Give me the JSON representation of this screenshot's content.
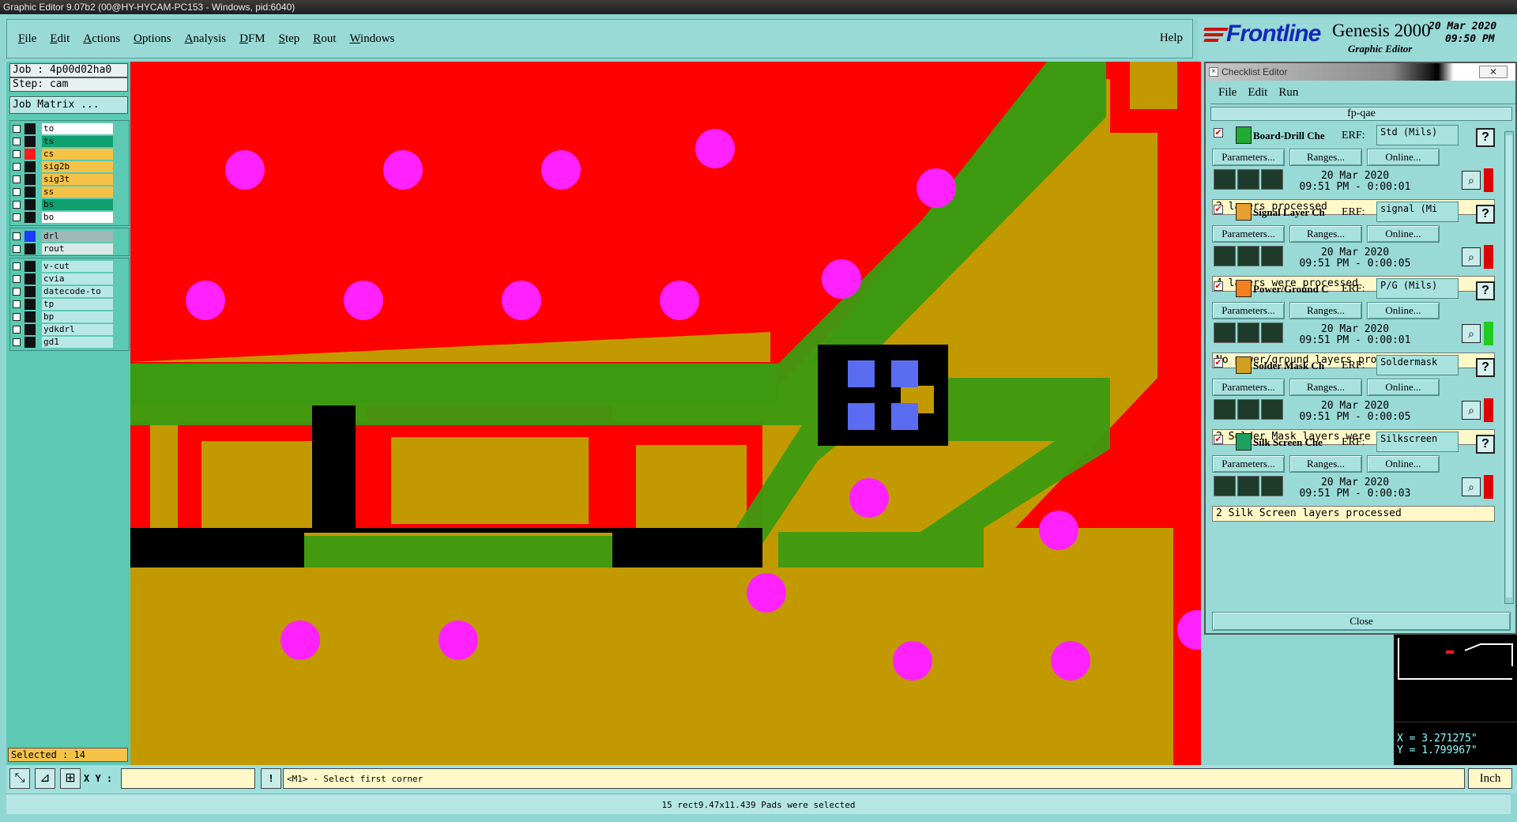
{
  "window_title": "Graphic Editor 9.07b2 (00@HY-HYCAM-PC153 - Windows, pid:6040)",
  "menu": [
    "File",
    "Edit",
    "Actions",
    "Options",
    "Analysis",
    "DFM",
    "Step",
    "Rout",
    "Windows"
  ],
  "help_label": "Help",
  "brand": {
    "logo": "Frontline",
    "product": "Genesis 2000",
    "subtitle": "Graphic Editor",
    "date": "20 Mar 2020",
    "time": "09:50 PM"
  },
  "job": {
    "job_label": "Job : 4p00d02ha0",
    "step_label": "Step: cam",
    "matrix_button": "Job Matrix ..."
  },
  "layers_group1": [
    {
      "name": "to",
      "color": "#ffffff",
      "swatch": "#111111"
    },
    {
      "name": "ts",
      "color": "#10a070",
      "swatch": "#111111"
    },
    {
      "name": "cs",
      "color": "#f4c247",
      "swatch": "#ff1a1a"
    },
    {
      "name": "sig2b",
      "color": "#f4c247",
      "swatch": "#111111"
    },
    {
      "name": "sig3t",
      "color": "#f4c247",
      "swatch": "#111111"
    },
    {
      "name": "ss",
      "color": "#f4c247",
      "swatch": "#111111"
    },
    {
      "name": "bs",
      "color": "#10a070",
      "swatch": "#111111"
    },
    {
      "name": "bo",
      "color": "#ffffff",
      "swatch": "#111111"
    }
  ],
  "layers_group2": [
    {
      "name": "drl",
      "color": "#a0b8b6",
      "swatch": "#1e3cff"
    },
    {
      "name": "rout",
      "color": "#d8e8e6",
      "swatch": "#111111"
    }
  ],
  "layers_group3": [
    {
      "name": "v-cut",
      "color": "#b8e8e6",
      "swatch": "#111111"
    },
    {
      "name": "cvia",
      "color": "#b8e8e6",
      "swatch": "#111111"
    },
    {
      "name": "datecode-to",
      "color": "#b8e8e6",
      "swatch": "#111111"
    },
    {
      "name": "tp",
      "color": "#b8e8e6",
      "swatch": "#111111"
    },
    {
      "name": "bp",
      "color": "#b8e8e6",
      "swatch": "#111111"
    },
    {
      "name": "ydkdrl",
      "color": "#b8e8e6",
      "swatch": "#111111"
    },
    {
      "name": "gd1",
      "color": "#b8e8e6",
      "swatch": "#111111"
    }
  ],
  "selected_label": "Selected : 14",
  "xy_label": "X Y :",
  "xy_value": "",
  "prompt": "<M1> - Select first corner",
  "units": "Inch",
  "status": "15 rect9.47x11.439 Pads were selected",
  "coords": {
    "x": "X = 3.271275\"",
    "y": "Y = 1.799967\""
  },
  "checklist": {
    "title": "Checklist Editor",
    "menu": [
      "File",
      "Edit",
      "Run"
    ],
    "name": "fp-qae",
    "param_label": "Parameters...",
    "ranges_label": "Ranges...",
    "online_label": "Online...",
    "erf_label": "ERF:",
    "close_label": "Close",
    "items": [
      {
        "name": "Board-Drill Che",
        "erf": "Std (Mils)",
        "date": "20 Mar 2020",
        "time": "09:51 PM - 0:00:01",
        "message": "2 layers processed",
        "status": "#e00000",
        "icon": "#22aa33"
      },
      {
        "name": "Signal Layer Ch",
        "erf": "signal (Mi",
        "date": "20 Mar 2020",
        "time": "09:51 PM - 0:00:05",
        "message": "4 layers were processed",
        "status": "#e00000",
        "icon": "#e8a030"
      },
      {
        "name": "Power/Ground C",
        "erf": "P/G (Mils)",
        "date": "20 Mar 2020",
        "time": "09:51 PM - 0:00:01",
        "message": "No power/ground layers processed",
        "status": "#20cc20",
        "icon": "#f08020"
      },
      {
        "name": "Solder Mask Ch",
        "erf": "Soldermask",
        "date": "20 Mar 2020",
        "time": "09:51 PM - 0:00:05",
        "message": "2 Solder Mask layers were processed",
        "status": "#e00000",
        "icon": "#d0a020"
      },
      {
        "name": "Silk Screen Che",
        "erf": "Silkscreen",
        "date": "20 Mar 2020",
        "time": "09:51 PM - 0:00:03",
        "message": "2 Silk Screen layers processed",
        "status": "#e00000",
        "icon": "#20a060"
      }
    ]
  }
}
